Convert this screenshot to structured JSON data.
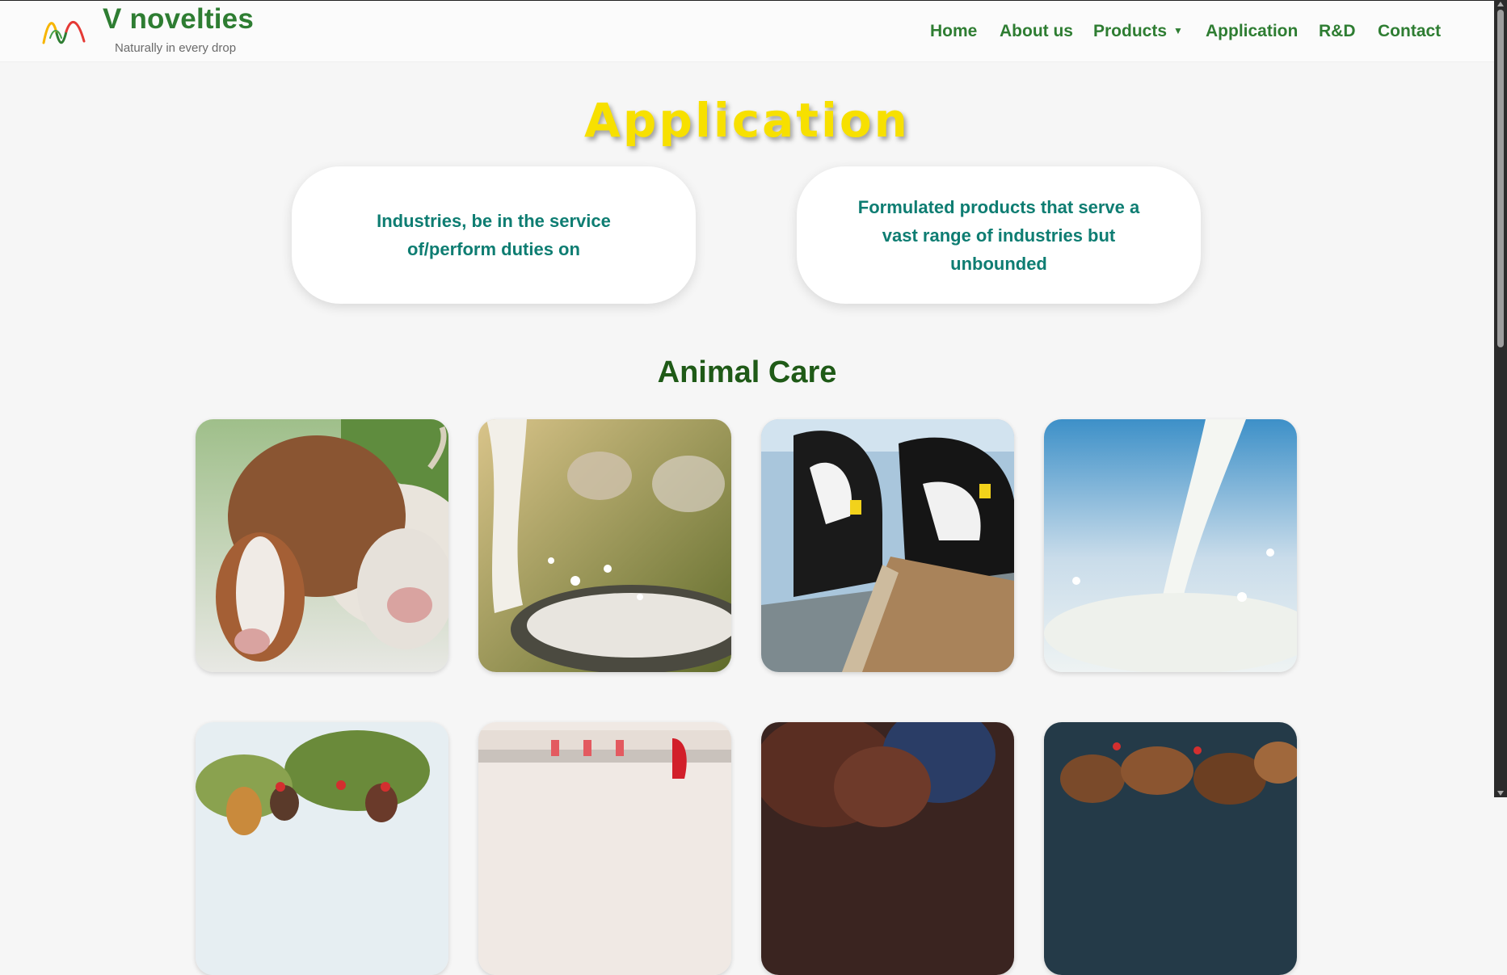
{
  "brand": {
    "name": "V novelties",
    "tagline": "Naturally in every drop",
    "colors": {
      "primary": "#2e7d32",
      "title_yellow": "#f7e000",
      "teal": "#0e7d72"
    }
  },
  "nav": {
    "items": [
      {
        "label": "Home"
      },
      {
        "label": "About us"
      },
      {
        "label": "Products",
        "has_dropdown": true
      },
      {
        "label": "Application"
      },
      {
        "label": "R&D"
      },
      {
        "label": "Contact"
      }
    ]
  },
  "main": {
    "title": "Application",
    "cards": [
      {
        "text": "Industries, be in the service of/perform duties on"
      },
      {
        "text": "Formulated products that serve a vast range of industries but unbounded"
      }
    ],
    "section": {
      "title": "Animal Care",
      "images": [
        {
          "subject": "brown and white cows"
        },
        {
          "subject": "milk pouring into trough with grazing cows"
        },
        {
          "subject": "holstein cows feeding at trough"
        },
        {
          "subject": "milk pouring splash"
        },
        {
          "subject": "chickens outdoors"
        },
        {
          "subject": "poultry drinker line"
        },
        {
          "subject": "hen close-up"
        },
        {
          "subject": "flock of hens"
        }
      ]
    }
  }
}
